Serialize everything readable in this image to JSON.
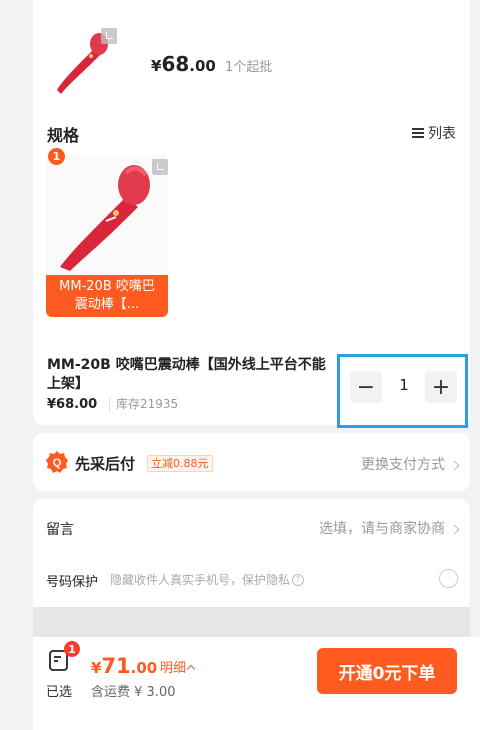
{
  "product": {
    "price_yen": "¥",
    "price_int": "68",
    "price_dec": ".00",
    "moq": "1个起批"
  },
  "spec": {
    "title": "规格",
    "list_label": "列表",
    "item_badge": "1",
    "item_label": "MM-20B 咬嘴巴震动棒【..."
  },
  "selected": {
    "name": "MM-20B 咬嘴巴震动棒【国外线上平台不能上架】",
    "price": "¥68.00",
    "stock": "库存21935",
    "quantity": "1",
    "minus": "−",
    "plus": "+"
  },
  "pay_later": {
    "title": "先采后付",
    "tag": "立减0.88元",
    "change": "更换支付方式"
  },
  "message": {
    "label": "留言",
    "value": "选填，请与商家协商"
  },
  "number_protect": {
    "label": "号码保护",
    "desc": "隐藏收件人真实手机号，保护隐私",
    "help": "?"
  },
  "footer": {
    "cart_badge": "1",
    "selected_label": "已选",
    "total_yen": "¥",
    "total_int": "71",
    "total_dec": ".00",
    "detail": "明细",
    "shipping": "含运费 ¥ 3.00",
    "order_button": "开通0元下单"
  },
  "colors": {
    "accent": "#ff5a1f",
    "product_red": "#d9263a",
    "highlight_box": "#2b9fe6"
  }
}
